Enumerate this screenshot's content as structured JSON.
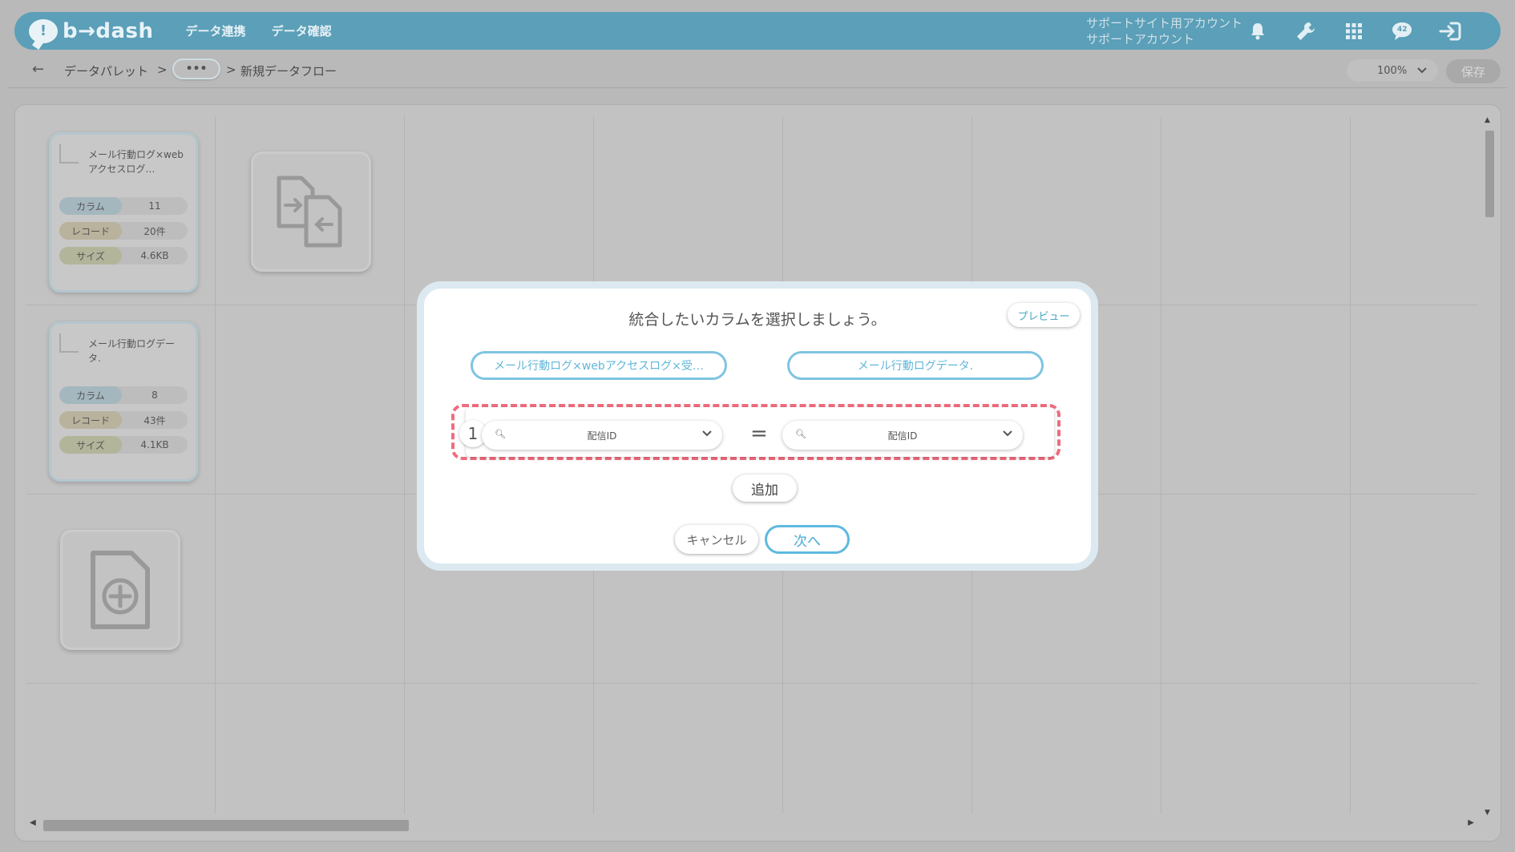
{
  "header": {
    "logo_text": "b→dash",
    "nav": [
      "データ連携",
      "データ確認"
    ],
    "account_line1": "サポートサイト用アカウント",
    "account_line2": "サポートアカウント",
    "badge": "42",
    "icons": [
      "bell-icon",
      "wrench-icon",
      "grid-icon",
      "chat-icon",
      "logout-icon"
    ]
  },
  "breadcrumb": {
    "back": "←",
    "root": "データパレット",
    "sep": ">",
    "ellipsis": "•••",
    "current": "新規データフロー"
  },
  "toolbar": {
    "zoom": "100%",
    "save_label": "保存"
  },
  "cards": [
    {
      "title": "メール行動ログ×webアクセスログ…",
      "column_label": "カラム",
      "column_value": "11",
      "record_label": "レコード",
      "record_value": "20件",
      "size_label": "サイズ",
      "size_value": "4.6KB"
    },
    {
      "title": "メール行動ログデータ.",
      "column_label": "カラム",
      "column_value": "8",
      "record_label": "レコード",
      "record_value": "43件",
      "size_label": "サイズ",
      "size_value": "4.1KB"
    }
  ],
  "modal": {
    "title": "統合したいカラムを選択しましょう。",
    "preview_label": "プレビュー",
    "left_table": "メール行動ログ×webアクセスログ×受…",
    "right_table": "メール行動ログデータ.",
    "conditions": [
      {
        "index": "1",
        "left_column": "配信ID",
        "operator": "=",
        "right_column": "配信ID"
      }
    ],
    "add_label": "追加",
    "cancel_label": "キャンセル",
    "next_label": "次へ"
  },
  "colors": {
    "header_bg": "#5b9fb8",
    "accent": "#5fb9df",
    "highlight": "#ef6d7e"
  }
}
